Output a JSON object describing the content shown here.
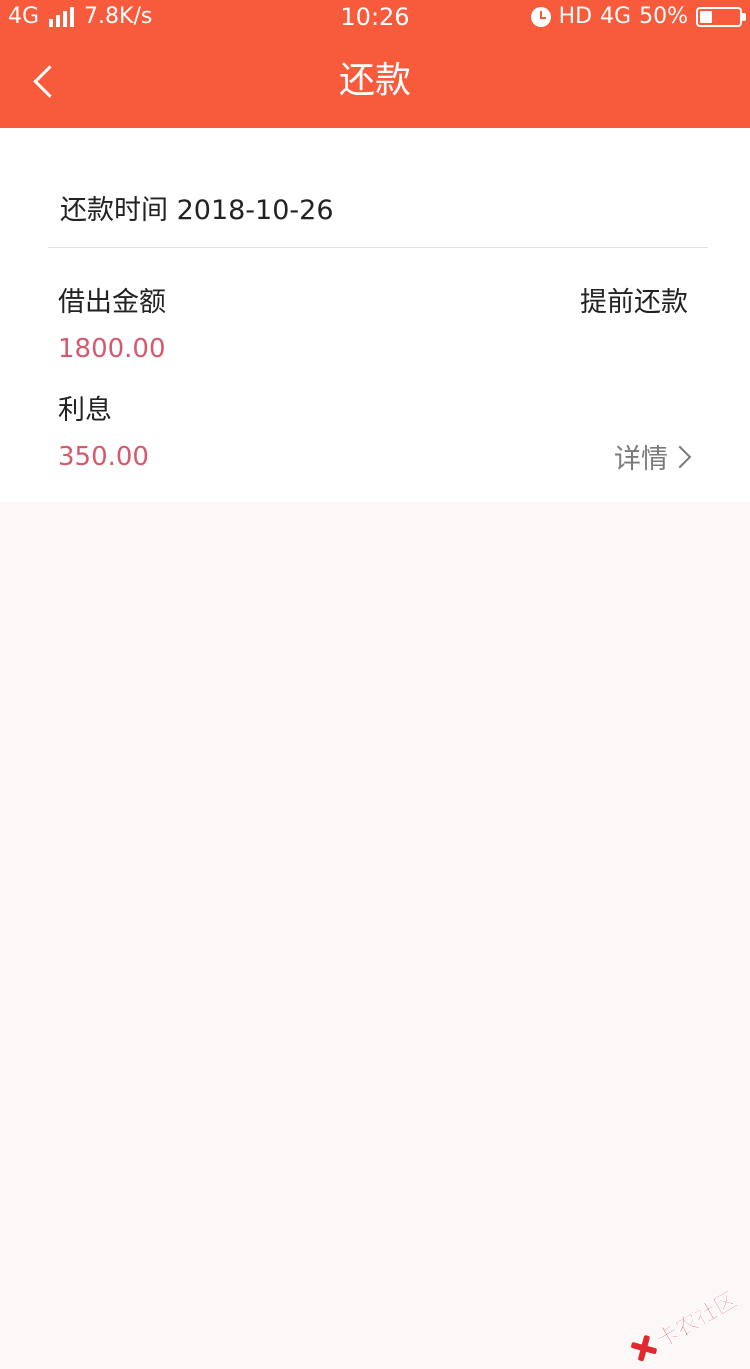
{
  "status_bar": {
    "network": "4G",
    "speed": "7.8K/s",
    "time": "10:26",
    "hd": "HD",
    "network_right": "4G",
    "battery": "50%"
  },
  "nav": {
    "title": "还款",
    "back_icon": "chevron-left-icon"
  },
  "loan": {
    "date_label": "还款时间",
    "date_value": "2018-10-26",
    "principal_label": "借出金额",
    "principal_value": "1800.00",
    "interest_label": "利息",
    "interest_value": "350.00",
    "prepay_label": "提前还款",
    "details_label": "详情"
  },
  "watermark": {
    "text": "卡农社区"
  },
  "colors": {
    "header": "#f85a3c",
    "amount": "#d65a6e",
    "background": "#fdf8f8"
  }
}
